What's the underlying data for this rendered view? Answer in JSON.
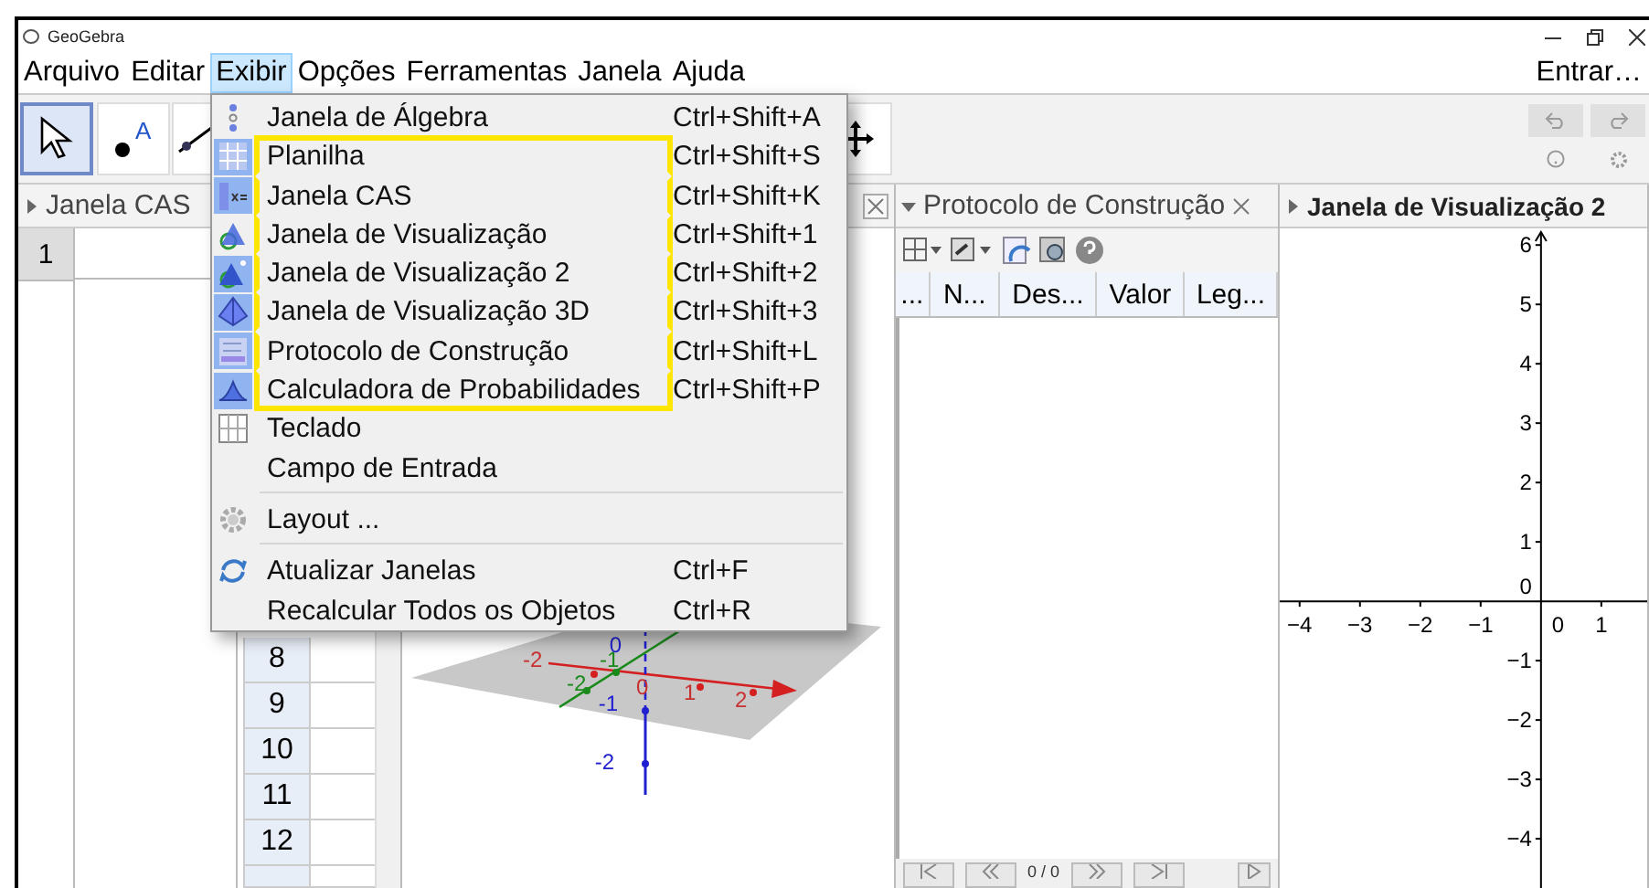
{
  "window": {
    "title": "GeoGebra"
  },
  "menu_bar": [
    {
      "label": "Arquivo",
      "selected": false
    },
    {
      "label": "Editar",
      "selected": false
    },
    {
      "label": "Exibir",
      "selected": true
    },
    {
      "label": "Opções",
      "selected": false
    },
    {
      "label": "Ferramentas",
      "selected": false
    },
    {
      "label": "Janela",
      "selected": false
    },
    {
      "label": "Ajuda",
      "selected": false
    }
  ],
  "sign_in": "Entrar…",
  "toolbar": {
    "tools": [
      {
        "kind": "move",
        "selected": true
      },
      {
        "kind": "point",
        "selected": false,
        "icon_text": "A"
      },
      {
        "kind": "line",
        "selected": false
      },
      {
        "kind": "move-view",
        "selected": false
      }
    ]
  },
  "cas_panel": {
    "title": "Janela CAS",
    "rows": [
      "1"
    ]
  },
  "spreadsheet": {
    "rows": [
      "8",
      "9",
      "10",
      "11",
      "12"
    ]
  },
  "view_3d": {
    "x_labels": [
      "-2",
      "0",
      "1",
      "2"
    ],
    "y_labels": [
      "-2",
      "-1"
    ],
    "z_labels": [
      "0",
      "-1",
      "-2"
    ]
  },
  "protocol_panel": {
    "title": "Protocolo de Construção",
    "columns": [
      "...",
      "N...",
      "Des...",
      "Valor",
      "Leg..."
    ],
    "counter": "0 / 0"
  },
  "graphics_2": {
    "title": "Janela de Visualização 2",
    "origin_x_label": "0",
    "origin_y_label": "0",
    "chart_data": {
      "type": "line",
      "xlim": [
        -4.33,
        1.79
      ],
      "ylim": [
        -4.86,
        6.28
      ],
      "xticks": [
        {
          "value": -4,
          "label": "−4"
        },
        {
          "value": -3,
          "label": "−3"
        },
        {
          "value": -2,
          "label": "−2"
        },
        {
          "value": -1,
          "label": "−1"
        },
        {
          "value": 1,
          "label": "1"
        }
      ],
      "yticks": [
        {
          "value": 6,
          "label": "6"
        },
        {
          "value": 5,
          "label": "5"
        },
        {
          "value": 4,
          "label": "4"
        },
        {
          "value": 3,
          "label": "3"
        },
        {
          "value": 2,
          "label": "2"
        },
        {
          "value": 1,
          "label": "1"
        },
        {
          "value": -1,
          "label": "−1"
        },
        {
          "value": -2,
          "label": "−2"
        },
        {
          "value": -3,
          "label": "−3"
        },
        {
          "value": -4,
          "label": "−4"
        }
      ]
    }
  },
  "view_menu": {
    "sections": [
      {
        "items": [
          {
            "kind": "algebra",
            "label": "Janela de Álgebra",
            "shortcut": "Ctrl+Shift+A",
            "checked": false,
            "outlined": false
          },
          {
            "kind": "spreadsheet",
            "label": "Planilha",
            "shortcut": "Ctrl+Shift+S",
            "checked": true,
            "outlined": true
          },
          {
            "kind": "cas",
            "label": "Janela CAS",
            "shortcut": "Ctrl+Shift+K",
            "checked": true,
            "outlined": true
          },
          {
            "kind": "graphics",
            "label": "Janela de Visualização",
            "shortcut": "Ctrl+Shift+1",
            "checked": false,
            "outlined": true
          },
          {
            "kind": "graphics2",
            "label": "Janela de Visualização 2",
            "shortcut": "Ctrl+Shift+2",
            "checked": true,
            "outlined": true
          },
          {
            "kind": "pyramid",
            "label": "Janela de Visualização 3D",
            "shortcut": "Ctrl+Shift+3",
            "checked": true,
            "outlined": true
          },
          {
            "kind": "protocol",
            "label": "Protocolo de Construção",
            "shortcut": "Ctrl+Shift+L",
            "checked": true,
            "outlined": true
          },
          {
            "kind": "probability",
            "label": "Calculadora de Probabilidades",
            "shortcut": "Ctrl+Shift+P",
            "checked": true,
            "outlined": true
          },
          {
            "kind": "keyboard",
            "label": "Teclado",
            "checked": false,
            "outlined": false
          },
          {
            "kind": "plain",
            "label": "Campo de Entrada",
            "checked": false,
            "outlined": false
          }
        ]
      },
      {
        "items": [
          {
            "kind": "gear",
            "label": "Layout ...",
            "checked": false,
            "outlined": false
          }
        ]
      },
      {
        "items": [
          {
            "kind": "refresh",
            "label": "Atualizar Janelas",
            "shortcut": "Ctrl+F",
            "checked": false,
            "outlined": false
          },
          {
            "kind": "plain",
            "label": "Recalcular Todos os Objetos",
            "shortcut": "Ctrl+R",
            "checked": false,
            "outlined": false
          }
        ]
      }
    ]
  }
}
